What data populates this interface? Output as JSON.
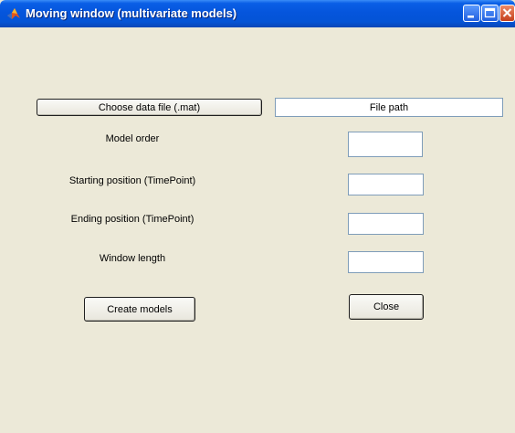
{
  "window": {
    "title": "Moving window (multivariate models)"
  },
  "titlebar_buttons": {
    "minimize_icon": "minimize-icon",
    "maximize_icon": "maximize-icon",
    "close_icon": "close-icon"
  },
  "file": {
    "choose_label": "Choose data file (.mat)",
    "path_text": "File path"
  },
  "params": {
    "model_order_label": "Model order",
    "model_order_value": "",
    "start_label": "Starting position (TimePoint)",
    "start_value": "",
    "end_label": "Ending position (TimePoint)",
    "end_value": "",
    "window_length_label": "Window length",
    "window_length_value": ""
  },
  "actions": {
    "create_label": "Create models",
    "close_label": "Close"
  },
  "colors": {
    "titlebar": "#0555dc",
    "window_bg": "#ece9d8",
    "field_border": "#7f9db9"
  }
}
